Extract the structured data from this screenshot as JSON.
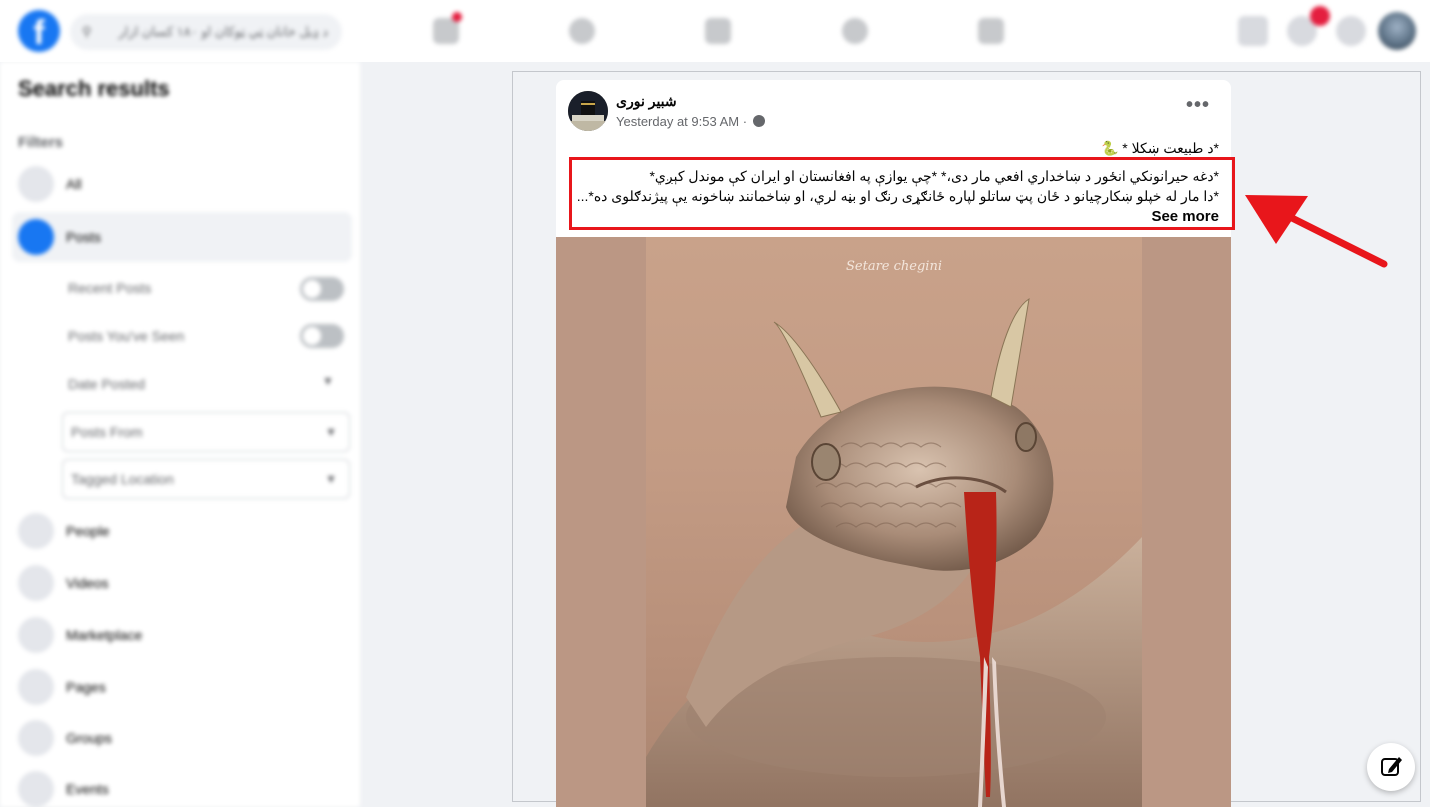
{
  "topbar": {
    "logo": "f",
    "search_placeholder": "د ډيل خانان ټي ټوکان او ۱۸۰ کسان ازار",
    "icons": [
      "search-icon",
      "home-icon",
      "watch-icon",
      "marketplace-icon",
      "groups-icon",
      "gaming-icon",
      "menu-icon",
      "messenger-icon",
      "notifications-icon",
      "account-icon"
    ]
  },
  "sidebar": {
    "title": "Search results",
    "filters_label": "Filters",
    "items": [
      {
        "label": "All",
        "icon": "all-icon"
      },
      {
        "label": "Posts",
        "icon": "posts-icon"
      },
      {
        "label": "People",
        "icon": "people-icon"
      },
      {
        "label": "Videos",
        "icon": "videos-icon"
      },
      {
        "label": "Marketplace",
        "icon": "marketplace-icon"
      },
      {
        "label": "Pages",
        "icon": "pages-icon"
      },
      {
        "label": "Groups",
        "icon": "groups-icon"
      },
      {
        "label": "Events",
        "icon": "events-icon"
      }
    ],
    "post_filters": {
      "recent_posts": "Recent Posts",
      "posts_seen": "Posts You've Seen",
      "date_posted": "Date Posted",
      "posts_from": "Posts From",
      "tagged_location": "Tagged Location"
    }
  },
  "post": {
    "author": "شبير نوری",
    "timestamp": "Yesterday at 9:53 AM",
    "separator": "·",
    "more_label": "•••",
    "text_line_1": "*د طبيعت ښکلا * 🐍",
    "text_line_2": "*دغه حيرانونکي انځور د ښاخداري افعي مار دی،* *چې يوازې په افغانستان او ايران کې موندل کېږي*",
    "text_line_3": "*دا مار له خپلو ښکارچيانو د ځان پټ ساتلو لپاره ځانګړی رنګ او بڼه لري، او ښاخمانند ښاخونه يې پيژندګلوی ده*...",
    "see_more": "See more",
    "image_watermark": "Setare chegini"
  },
  "colors": {
    "highlight": "#e8161b",
    "fb_blue": "#1877f2"
  }
}
